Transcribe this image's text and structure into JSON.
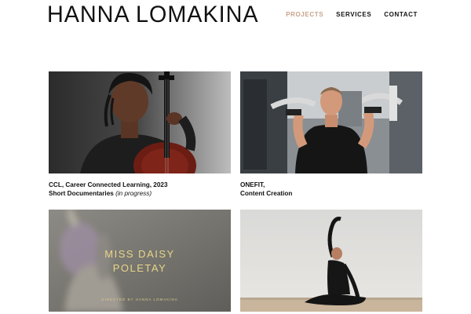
{
  "header": {
    "site_title": "HANNA LOMAKINA",
    "nav": [
      {
        "label": "PROJECTS",
        "active": true
      },
      {
        "label": "SERVICES",
        "active": false
      },
      {
        "label": "CONTACT",
        "active": false
      }
    ]
  },
  "projects": [
    {
      "caption_line1": "CCL, Career Connected Learning, 2023",
      "caption_line2": "Short Documentaries",
      "caption_note": "(in progress)",
      "image": "cellist-portrait"
    },
    {
      "caption_line1": "ONEFIT,",
      "caption_line2": "Content Creation",
      "image": "gym-workout"
    },
    {
      "image": "miss-daisy-poster",
      "poster_title_1": "MISS DAISY",
      "poster_title_2": "POLETAY",
      "poster_credit": "DIRECTED BY HANNA LOMAKINA"
    },
    {
      "image": "beach-stretch"
    }
  ],
  "colors": {
    "accent": "#c9a38a",
    "text": "#111111",
    "poster_text": "#e8d58a"
  }
}
